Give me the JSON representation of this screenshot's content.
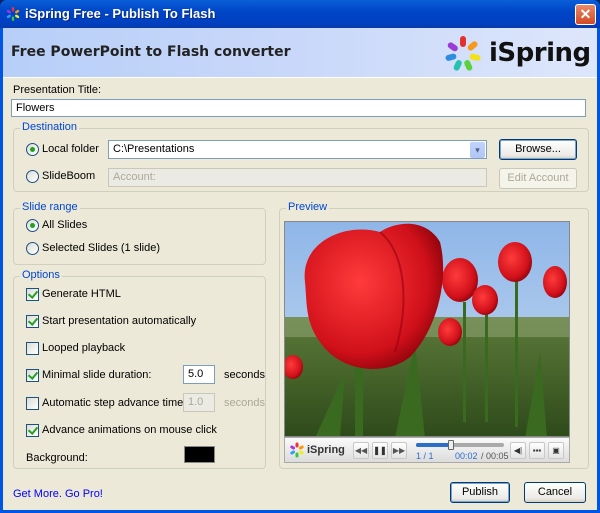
{
  "window": {
    "title": "iSpring Free - Publish To Flash",
    "close_label": "✕"
  },
  "header": {
    "title": "Free PowerPoint to Flash converter",
    "logo_text": "iSpring"
  },
  "presentation": {
    "title_label": "Presentation Title:",
    "title_value": "Flowers"
  },
  "destination": {
    "group_title": "Destination",
    "local_folder_label": "Local folder",
    "local_folder_selected": true,
    "local_folder_value": "C:\\Presentations",
    "browse_label": "Browse...",
    "slideboom_label": "SlideBoom",
    "slideboom_selected": false,
    "account_placeholder": "Account:",
    "edit_account_label": "Edit Account"
  },
  "slide_range": {
    "group_title": "Slide range",
    "options": [
      {
        "label": "All Slides",
        "selected": true
      },
      {
        "label": "Selected Slides (1 slide)",
        "selected": false
      }
    ]
  },
  "options": {
    "group_title": "Options",
    "generate_html": {
      "label": "Generate HTML",
      "checked": true
    },
    "start_auto": {
      "label": "Start presentation automatically",
      "checked": true
    },
    "looped": {
      "label": "Looped playback",
      "checked": false
    },
    "min_duration": {
      "label": "Minimal slide duration:",
      "checked": true,
      "value": "5.0",
      "unit": "seconds"
    },
    "auto_step": {
      "label": "Automatic step advance time:",
      "checked": false,
      "value": "1.0",
      "unit": "seconds"
    },
    "advance_click": {
      "label": "Advance animations on mouse click",
      "checked": true
    },
    "background_label": "Background:",
    "background_color": "#000000"
  },
  "preview": {
    "group_title": "Preview",
    "player": {
      "brand": "iSpring",
      "slide_counter": "1 / 1",
      "time_current": "00:02",
      "time_total": "/ 00:05",
      "progress_fraction": 0.4
    }
  },
  "footer": {
    "promo_link": "Get More. Go Pro!",
    "publish_label": "Publish",
    "cancel_label": "Cancel"
  }
}
